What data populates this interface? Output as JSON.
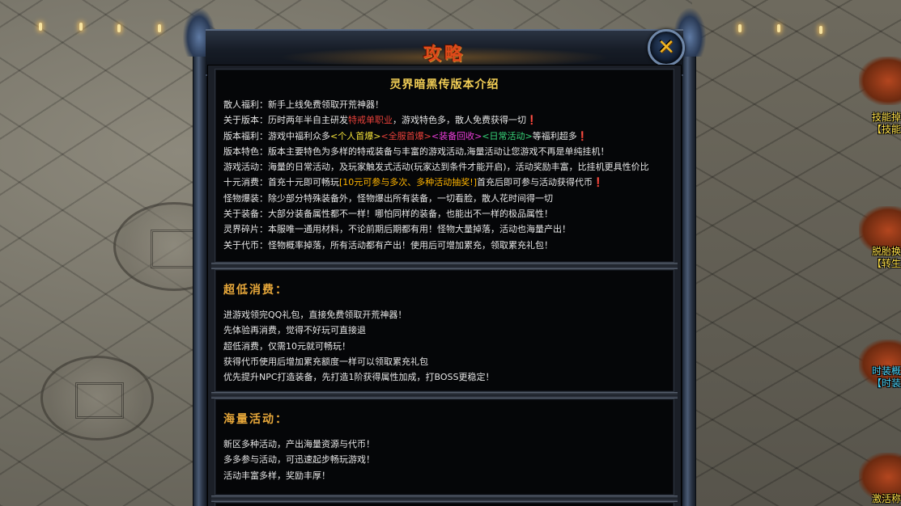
{
  "dialog": {
    "title": "攻略",
    "close_icon": "✕",
    "intro": {
      "title": "灵界暗黑传版本介绍",
      "lines": [
        [
          {
            "t": "散人福利：新手上线免费领取开荒神器！"
          }
        ],
        [
          {
            "t": "关于版本：历时两年半自主研发"
          },
          {
            "t": "特戒单职业",
            "c": "hl-red"
          },
          {
            "t": "，游戏特色多，散人免费获得一切❗"
          }
        ],
        [
          {
            "t": "版本福利：游戏中福利众多"
          },
          {
            "t": "<个人首爆>",
            "c": "hl-yellow"
          },
          {
            "t": "<全服首爆>",
            "c": "hl-red"
          },
          {
            "t": "<装备回收>",
            "c": "hl-pink"
          },
          {
            "t": "<日常活动>",
            "c": "hl-green"
          },
          {
            "t": "等福利超多❗"
          }
        ],
        [
          {
            "t": "版本特色：版本主要特色为多样的特戒装备与丰富的游戏活动,海量活动让您游戏不再是单纯挂机！"
          }
        ],
        [
          {
            "t": "游戏活动：海量的日常活动，及玩家触发式活动(玩家达到条件才能开启)，活动奖励丰富，比挂机更具性价比"
          }
        ],
        [
          {
            "t": "十元消费：首充十元即可畅玩"
          },
          {
            "t": "[10元可参与多次、多种活动抽奖!]",
            "c": "hl-orange"
          },
          {
            "t": "首充后即可参与活动获得代币❗"
          }
        ],
        [
          {
            "t": "怪物爆装：除少部分特殊装备外，怪物爆出所有装备，一切看脸，散人花时间得一切"
          }
        ],
        [
          {
            "t": "关于装备：大部分装备属性都不一样！哪怕同样的装备，也能出不一样的极品属性！"
          }
        ],
        [
          {
            "t": "灵界碎片：本服唯一通用材料，不论前期后期都有用！怪物大量掉落，活动也海量产出！"
          }
        ],
        [
          {
            "t": "关于代币：怪物概率掉落，所有活动都有产出！使用后可增加累充，领取累充礼包！"
          }
        ]
      ]
    },
    "low_cost": {
      "title": "超低消费：",
      "lines": [
        "进游戏领完QQ礼包，直接免费领取开荒神器！",
        "先体验再消费，觉得不好玩可直接退",
        "超低消费，仅需10元就可畅玩！",
        "获得代币使用后增加累充额度一样可以领取累充礼包",
        "优先提升NPC打造装备，先打造1阶获得属性加成，打BOSS更稳定！"
      ]
    },
    "activities": {
      "title": "海量活动：",
      "lines": [
        "新区多种活动，产出海量资源与代币！",
        "多多参与活动，可迅速起步畅玩游戏！",
        "活动丰富多样，奖励丰厚！"
      ]
    }
  },
  "side_labels": [
    {
      "text": "技能掉",
      "color": "#ffe14a"
    },
    {
      "text": "【技能",
      "color": "#ffe14a"
    },
    {
      "text": "脱胎换",
      "color": "#ffe14a"
    },
    {
      "text": "【转生",
      "color": "#ffe14a"
    },
    {
      "text": "时装概",
      "color": "#4ad8ff"
    },
    {
      "text": "【时装",
      "color": "#4ad8ff"
    },
    {
      "text": "激活称",
      "color": "#ffe14a"
    }
  ]
}
